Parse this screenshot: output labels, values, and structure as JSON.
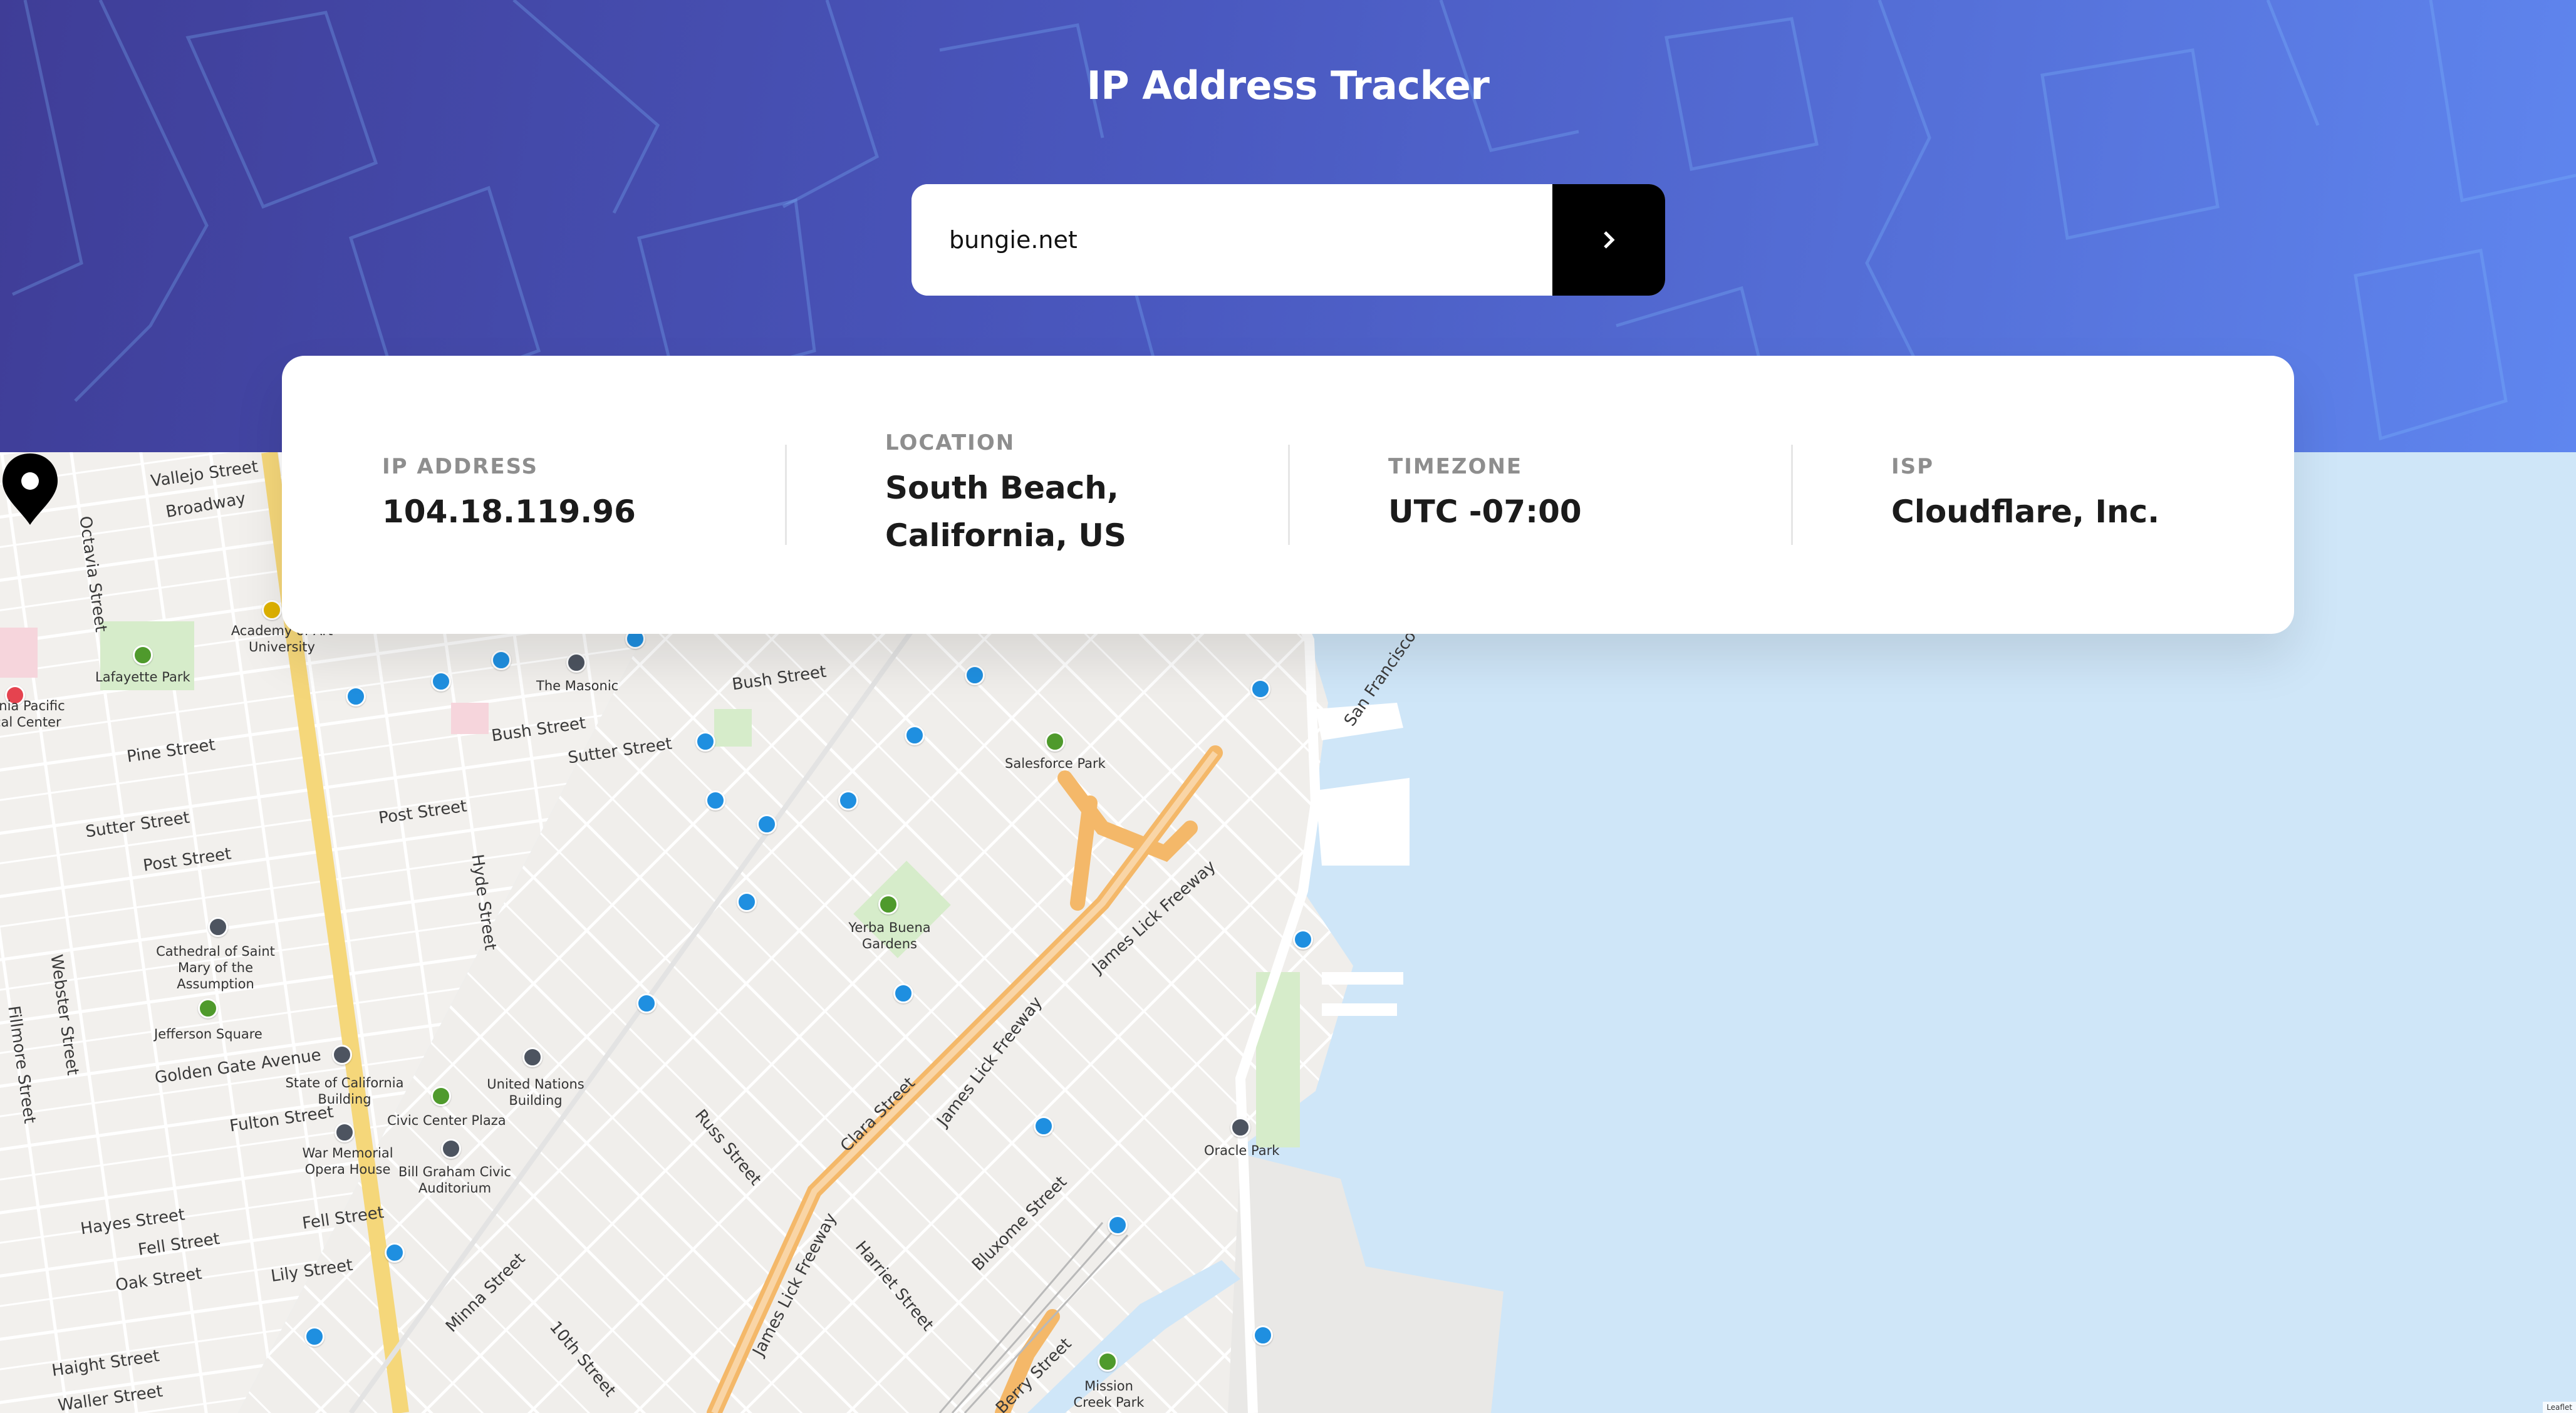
{
  "header": {
    "title": "IP Address Tracker"
  },
  "search": {
    "value": "bungie.net",
    "button_icon": "chevron-right-icon"
  },
  "info": {
    "ip_label": "IP ADDRESS",
    "ip_value": "104.18.119.96",
    "location_label": "LOCATION",
    "location_line1": "South Beach,",
    "location_line2": "California, US",
    "timezone_label": "TIMEZONE",
    "timezone_value": "UTC -07:00",
    "isp_label": "ISP",
    "isp_value": "Cloudflare, Inc."
  },
  "map": {
    "streets": {
      "vallejo": "Vallejo Street",
      "broadway": "Broadway",
      "octavia": "Octavia Street",
      "bush1": "Bush Street",
      "bush2": "Bush Street",
      "pine": "Pine Street",
      "sutter1": "Sutter Street",
      "sutter2": "Sutter Street",
      "post1": "Post Street",
      "post2": "Post Street",
      "hyde": "Hyde Street",
      "webster": "Webster Street",
      "fillmore": "Fillmore Street",
      "golden_gate": "Golden Gate Avenue",
      "fulton": "Fulton Street",
      "hayes": "Hayes Street",
      "fell1": "Fell Street",
      "fell2": "Fell Street",
      "oak": "Oak Street",
      "lily": "Lily Street",
      "haight": "Haight Street",
      "waller": "Waller Street",
      "minna": "Minna Street",
      "tenth": "10th Street",
      "russ": "Russ Street",
      "clara": "Clara Street",
      "harriet": "Harriet Street",
      "bluxome": "Bluxome Street",
      "berry": "Berry Street",
      "james_lick1": "James Lick Freeway",
      "james_lick2": "James Lick Freeway",
      "james_lick3": "James Lick Freeway",
      "sf_bay": "San Francisco"
    },
    "places": {
      "lafayette": "Lafayette Park",
      "academy": "Academy of Art University",
      "masonic": "The Masonic",
      "medical": "rnia Pacific cal Center",
      "salesforce": "Salesforce Park",
      "yerba": "Yerba Buena Gardens",
      "cathedral": "Cathedral of Saint Mary of the Assumption",
      "jefferson": "Jefferson Square",
      "state_bldg": "State of California Building",
      "un_bldg": "United Nations Building",
      "civic": "Civic Center Plaza",
      "war_memorial": "War Memorial Opera House",
      "graham": "Bill Graham Civic Auditorium",
      "oracle": "Oracle Park",
      "mission_creek": "Mission Creek Park"
    },
    "attribution": "Leaflet",
    "colors": {
      "water": "#cfe6f8",
      "land": "#f1efec",
      "freeway": "#f6c17a",
      "transit": "#1f8fe0"
    }
  }
}
